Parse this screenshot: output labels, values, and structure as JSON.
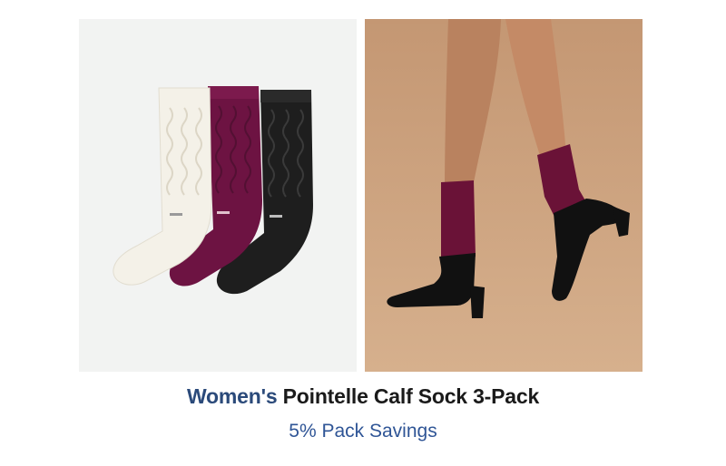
{
  "product": {
    "title_prefix": "Women's",
    "title_main": "Pointelle Calf Sock 3-Pack",
    "subtitle": "5% Pack Savings"
  },
  "images": {
    "pack_photo": {
      "icon": "sock-pack-image",
      "sock_colors": [
        "#f4f1e8",
        "#6d1342",
        "#1c1c1c"
      ]
    },
    "model_photo": {
      "icon": "model-legs-image",
      "background": "#c99f7b"
    }
  },
  "colors": {
    "brand_text": "#2b4a7a",
    "title_text": "#1a1a1a",
    "subtitle_text": "#2f5596"
  }
}
